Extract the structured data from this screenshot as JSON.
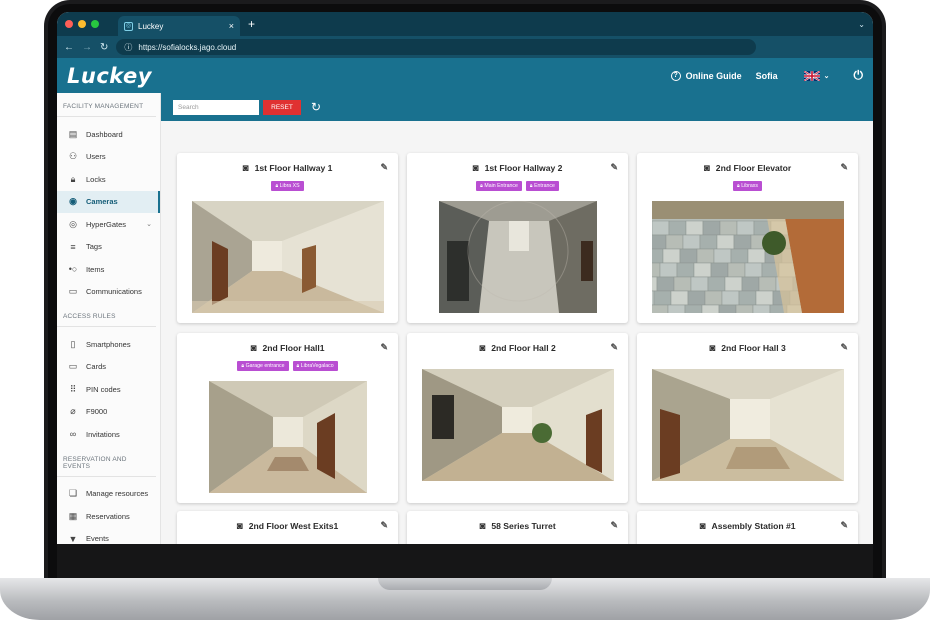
{
  "browser": {
    "tab_title": "Luckey",
    "url": "https://sofialocks.jago.cloud",
    "new_tab": "+",
    "tab_close": "×"
  },
  "header": {
    "logo": "Luckey",
    "guide_label": "Online Guide",
    "user_name": "Sofia"
  },
  "sidebar": {
    "sections": [
      {
        "title": "FACILITY MANAGEMENT",
        "items": [
          {
            "label": "Dashboard",
            "icon": "monitor-icon",
            "glyph": "▤"
          },
          {
            "label": "Users",
            "icon": "users-icon",
            "glyph": "⚇"
          },
          {
            "label": "Locks",
            "icon": "lock-icon",
            "glyph": "🔒︎"
          },
          {
            "label": "Cameras",
            "icon": "camera-icon",
            "glyph": "◉",
            "active": true
          },
          {
            "label": "HyperGates",
            "icon": "hypergate-icon",
            "glyph": "◎",
            "expandable": true
          },
          {
            "label": "Tags",
            "icon": "tag-icon",
            "glyph": "≡"
          },
          {
            "label": "Items",
            "icon": "item-icon",
            "glyph": "•○"
          },
          {
            "label": "Communications",
            "icon": "message-icon",
            "glyph": "▭"
          }
        ]
      },
      {
        "title": "ACCESS RULES",
        "items": [
          {
            "label": "Smartphones",
            "icon": "smartphone-icon",
            "glyph": "▯"
          },
          {
            "label": "Cards",
            "icon": "card-icon",
            "glyph": "▭"
          },
          {
            "label": "PIN codes",
            "icon": "pin-icon",
            "glyph": "⠿"
          },
          {
            "label": "F9000",
            "icon": "f9000-icon",
            "glyph": "⌀"
          },
          {
            "label": "Invitations",
            "icon": "link-icon",
            "glyph": "∞"
          }
        ]
      },
      {
        "title": "RESERVATION AND EVENTS",
        "items": [
          {
            "label": "Manage resources",
            "icon": "resource-icon",
            "glyph": "❏"
          },
          {
            "label": "Reservations",
            "icon": "calendar-icon",
            "glyph": "▦"
          },
          {
            "label": "Events",
            "icon": "filter-icon",
            "glyph": "▼"
          }
        ]
      }
    ]
  },
  "toolbar": {
    "search_placeholder": "Search",
    "reset_label": "RESET"
  },
  "cameras": [
    {
      "name": "1st Floor Hallway 1",
      "tags": [
        "Libra XS"
      ],
      "scene": "hall-left"
    },
    {
      "name": "1st Floor Hallway 2",
      "tags": [
        "Main Entrance",
        "Entrance"
      ],
      "scene": "fisheye"
    },
    {
      "name": "2nd Floor Elevator",
      "tags": [
        "Libraxs"
      ],
      "scene": "tiles"
    },
    {
      "name": "2nd Floor Hall1",
      "tags": [
        "Garage entrance",
        "LibraVegalaco"
      ],
      "scene": "hall-center"
    },
    {
      "name": "2nd Floor Hall 2",
      "tags": [],
      "scene": "hall-wide"
    },
    {
      "name": "2nd Floor Hall 3",
      "tags": [],
      "scene": "hall-corridor"
    },
    {
      "name": "2nd Floor West Exits1",
      "tags": [],
      "scene": "none"
    },
    {
      "name": "58 Series Turret",
      "tags": [],
      "scene": "none"
    },
    {
      "name": "Assembly Station #1",
      "tags": [],
      "scene": "none"
    }
  ],
  "colors": {
    "header": "#19718f",
    "browser_dark": "#0e3b4d",
    "reset": "#e03131",
    "tag": "#b94ed2"
  }
}
